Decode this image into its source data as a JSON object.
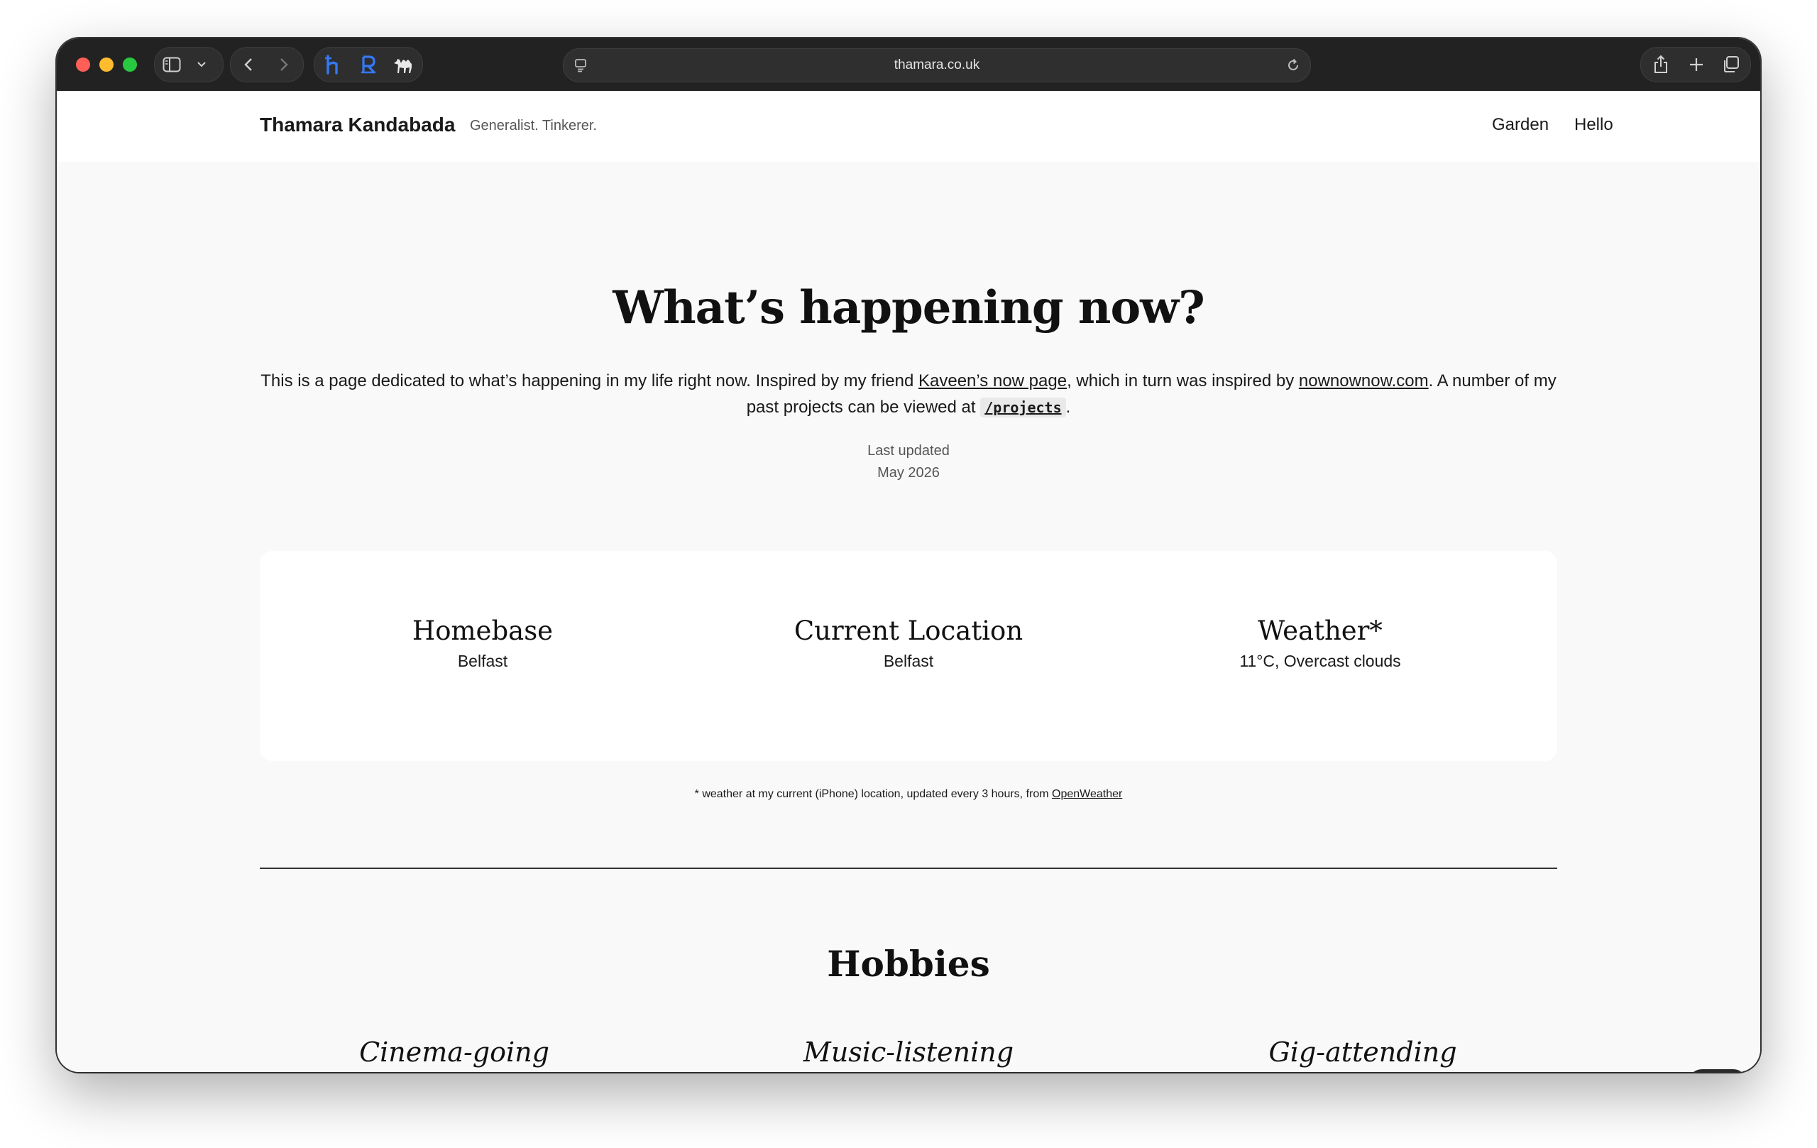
{
  "browser": {
    "url": "thamara.co.uk",
    "colors": {
      "close": "#ff5f57",
      "minimize": "#febc2e",
      "zoom": "#28c840",
      "accent": "#3478f6"
    },
    "extension_icons": [
      "hugo-h-icon",
      "r-icon",
      "camel-icon"
    ]
  },
  "header": {
    "brand": "Thamara Kandabada",
    "tagline": "Generalist. Tinkerer.",
    "nav": [
      "Garden",
      "Hello"
    ]
  },
  "main": {
    "title": "What’s happening now?",
    "intro": {
      "t1": "This is a page dedicated to what’s happening in my life right now. Inspired by my friend ",
      "link1": "Kaveen’s now page",
      "t2": ", which in turn was inspired by ",
      "link2": "nownownow.com",
      "t3": ". A number of my past projects can be viewed at ",
      "code": "/projects",
      "t4": "."
    },
    "last_updated_label": "Last updated",
    "last_updated_value": "May 2026"
  },
  "stats": [
    {
      "label": "Homebase",
      "value": "Belfast"
    },
    {
      "label": "Current Location",
      "value": "Belfast"
    },
    {
      "label": "Weather*",
      "value": "11°C, Overcast clouds"
    }
  ],
  "footnote": {
    "text": "* weather at my current (iPhone) location, updated every 3 hours, from ",
    "link": "OpenWeather"
  },
  "hobbies": {
    "heading": "Hobbies",
    "items": [
      "Cinema-going",
      "Music-listening",
      "Gig-attending"
    ]
  },
  "theme_toggle": {
    "icon": "moon-icon"
  }
}
